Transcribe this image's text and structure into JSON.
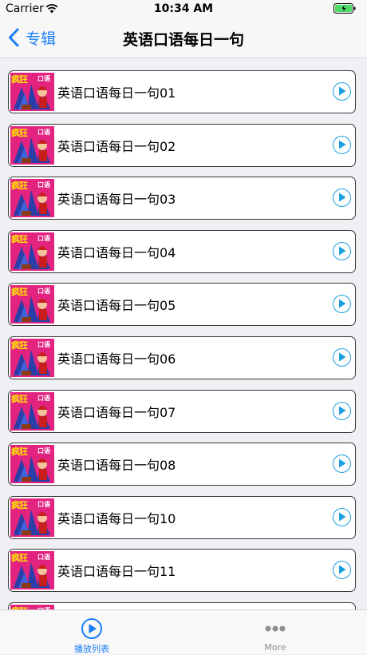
{
  "status_bar": {
    "carrier": "Carrier",
    "time": "10:34 AM"
  },
  "nav": {
    "back_label": "专辑",
    "title": "英语口语每日一句"
  },
  "thumbnail": {
    "title_text": "疯狂",
    "subtitle_text": "口语"
  },
  "list": {
    "items": [
      {
        "label": "英语口语每日一句01"
      },
      {
        "label": "英语口语每日一句02"
      },
      {
        "label": "英语口语每日一句03"
      },
      {
        "label": "英语口语每日一句04"
      },
      {
        "label": "英语口语每日一句05"
      },
      {
        "label": "英语口语每日一句06"
      },
      {
        "label": "英语口语每日一句07"
      },
      {
        "label": "英语口语每日一句08"
      },
      {
        "label": "英语口语每日一句10"
      },
      {
        "label": "英语口语每日一句11"
      }
    ]
  },
  "tabbar": {
    "playlist_label": "播放列表",
    "more_label": "More"
  },
  "colors": {
    "accent": "#1a7ef7",
    "play_icon": "#1a9fe0",
    "battery": "#4cd964",
    "thumbnail_bg": "#e2237f"
  }
}
